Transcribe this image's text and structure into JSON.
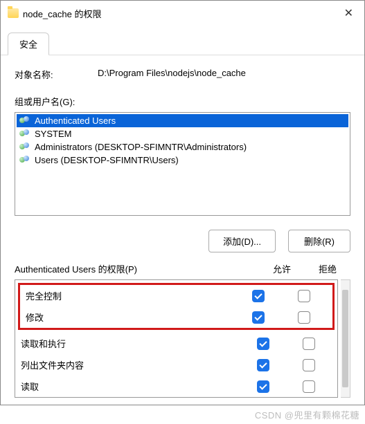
{
  "title": "node_cache 的权限",
  "tab": {
    "security": "安全"
  },
  "object": {
    "label": "对象名称:",
    "value": "D:\\Program Files\\nodejs\\node_cache"
  },
  "groups": {
    "label": "组或用户名(G):",
    "items": [
      {
        "name": "Authenticated Users",
        "selected": true
      },
      {
        "name": "SYSTEM",
        "selected": false
      },
      {
        "name": "Administrators (DESKTOP-SFIMNTR\\Administrators)",
        "selected": false
      },
      {
        "name": "Users (DESKTOP-SFIMNTR\\Users)",
        "selected": false
      }
    ]
  },
  "buttons": {
    "add": "添加(D)...",
    "remove": "删除(R)"
  },
  "permissions": {
    "header": "Authenticated Users 的权限(P)",
    "allow": "允许",
    "deny": "拒绝",
    "rows": [
      {
        "name": "完全控制",
        "allow": true,
        "deny": false,
        "highlight": true
      },
      {
        "name": "修改",
        "allow": true,
        "deny": false,
        "highlight": true
      },
      {
        "name": "读取和执行",
        "allow": true,
        "deny": false,
        "highlight": false
      },
      {
        "name": "列出文件夹内容",
        "allow": true,
        "deny": false,
        "highlight": false
      },
      {
        "name": "读取",
        "allow": true,
        "deny": false,
        "highlight": false
      }
    ]
  },
  "watermark": "CSDN @兜里有颗棉花糖"
}
